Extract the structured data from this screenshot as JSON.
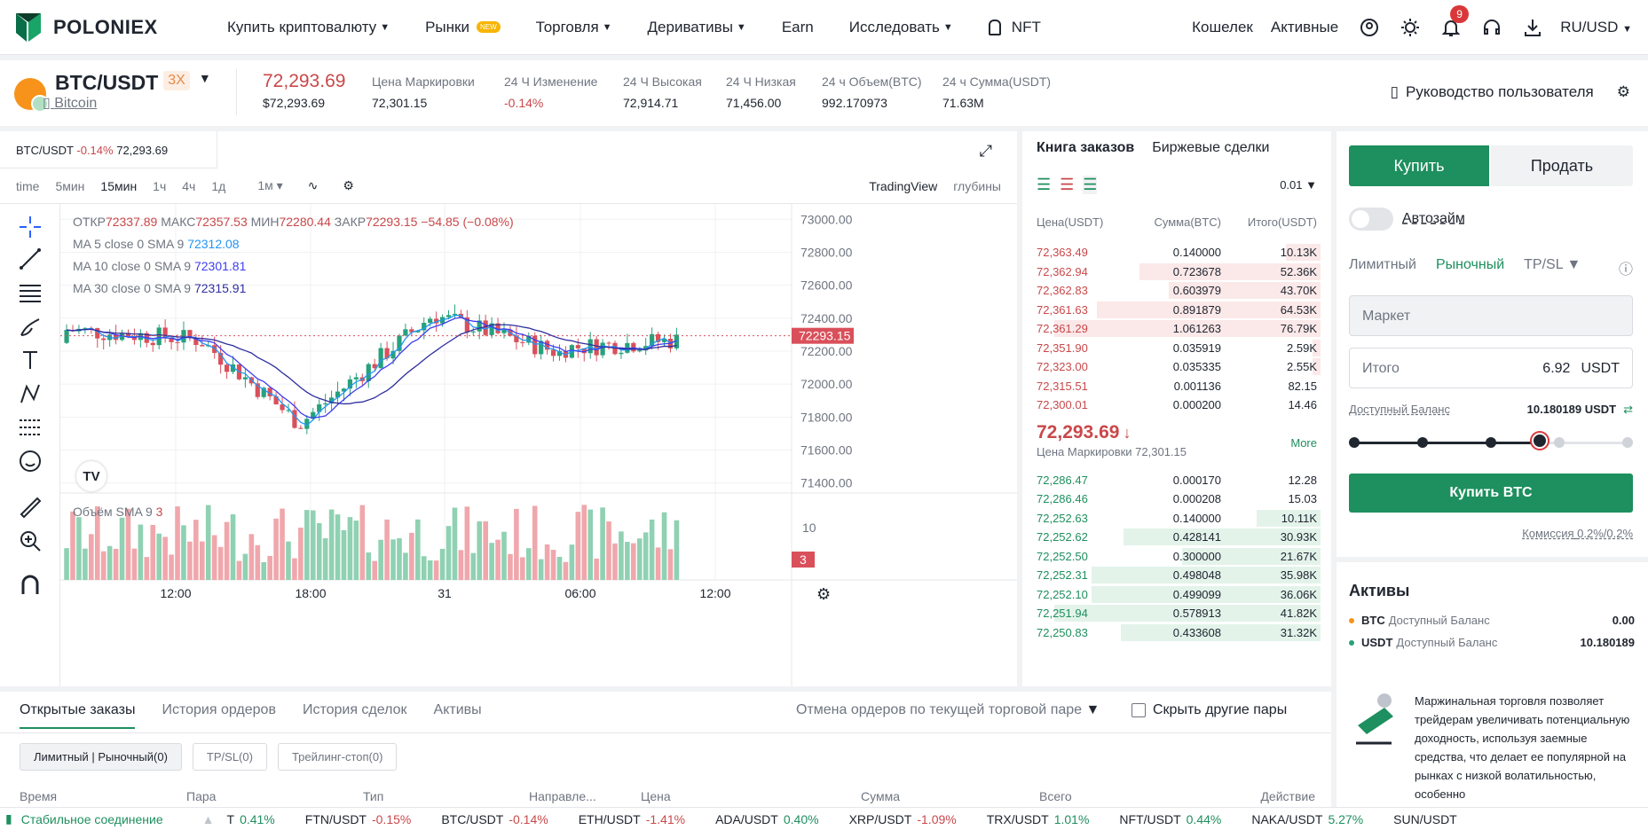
{
  "brand": {
    "name": "POLONIEX"
  },
  "nav": {
    "buy_crypto": "Купить криптовалюту",
    "markets": "Рынки",
    "markets_badge": "NEW",
    "trading": "Торговля",
    "derivatives": "Деривативы",
    "earn": "Earn",
    "explore": "Исследовать",
    "nft": "NFT",
    "wallet": "Кошелек",
    "assets": "Активные",
    "notif_count": "9",
    "lang": "RU/USD"
  },
  "ticker": {
    "pair": "BTC/USDT",
    "leverage": "3X",
    "coin_name": "Bitcoin",
    "last_price": "72,293.69",
    "last_price_usd": "$72,293.69",
    "stats": [
      {
        "label": "Цена Маркировки",
        "value": "72,301.15"
      },
      {
        "label": "24 Ч Изменение",
        "value": "-0.14%"
      },
      {
        "label": "24 Ч Высокая",
        "value": "72,914.71"
      },
      {
        "label": "24 Ч Низкая",
        "value": "71,456.00"
      },
      {
        "label": "24 ч Объем(BTC)",
        "value": "992.170973"
      },
      {
        "label": "24 ч Сумма(USDT)",
        "value": "71.63M"
      }
    ],
    "guide": "Руководство пользователя"
  },
  "chart": {
    "tab_pair": "BTC/USDT",
    "tab_change": "-0.14%",
    "tab_price": "72,293.69",
    "timeframes": [
      "time",
      "5мин",
      "15мин",
      "1ч",
      "4ч",
      "1д",
      "1м"
    ],
    "active_tf": "15мин",
    "view_tv": "TradingView",
    "view_depth": "глубины",
    "ohlc": {
      "o_label": "ОТКР",
      "o": "72337.89",
      "h_label": "МАКС",
      "h": "72357.53",
      "l_label": "МИН",
      "l": "72280.44",
      "c_label": "ЗАКР",
      "c": "72293.15",
      "chg": "−54.85 (−0.08%)"
    },
    "ma": [
      {
        "label": "MA 5 close 0 SMA 9",
        "value": "72312.08",
        "color": "#2196f3"
      },
      {
        "label": "MA 10 close 0 SMA 9",
        "value": "72301.81",
        "color": "#3d3df0"
      },
      {
        "label": "MA 30 close 0 SMA 9",
        "value": "72315.91",
        "color": "#2e2e9e"
      }
    ],
    "volume_label": "Объём SMA 9",
    "volume_value": "3",
    "price_ticks": [
      "73000.00",
      "72800.00",
      "72600.00",
      "72400.00",
      "72200.00",
      "72000.00",
      "71800.00",
      "71600.00",
      "71400.00"
    ],
    "current_price_tag": "72293.15",
    "vol_tick": "10",
    "vol_tag": "3",
    "time_ticks": [
      "12:00",
      "18:00",
      "31",
      "06:00",
      "12:00"
    ]
  },
  "chart_data": {
    "type": "candlestick",
    "x": [
      "12:00",
      "18:00",
      "31",
      "06:00",
      "12:00"
    ],
    "ylim": [
      71350,
      73050
    ],
    "last": 72293.15
  },
  "book": {
    "tab_book": "Книга заказов",
    "tab_trades": "Биржевые сделки",
    "precision": "0.01",
    "hdr_price": "Цена(USDT)",
    "hdr_size": "Сумма(BTC)",
    "hdr_total": "Итого(USDT)",
    "asks": [
      {
        "p": "72,363.49",
        "s": "0.140000",
        "t": "10.13K",
        "d": 0.13
      },
      {
        "p": "72,362.94",
        "s": "0.723678",
        "t": "52.36K",
        "d": 0.68
      },
      {
        "p": "72,362.83",
        "s": "0.603979",
        "t": "43.70K",
        "d": 0.57
      },
      {
        "p": "72,361.63",
        "s": "0.891879",
        "t": "64.53K",
        "d": 0.84
      },
      {
        "p": "72,361.29",
        "s": "1.061263",
        "t": "76.79K",
        "d": 1.0
      },
      {
        "p": "72,351.90",
        "s": "0.035919",
        "t": "2.59K",
        "d": 0.03
      },
      {
        "p": "72,323.00",
        "s": "0.035335",
        "t": "2.55K",
        "d": 0.03
      },
      {
        "p": "72,315.51",
        "s": "0.001136",
        "t": "82.15",
        "d": 0.0
      },
      {
        "p": "72,300.01",
        "s": "0.000200",
        "t": "14.46",
        "d": 0.0
      }
    ],
    "mid_price": "72,293.69",
    "mark_label": "Цена Маркировки 72,301.15",
    "more": "More",
    "bids": [
      {
        "p": "72,286.47",
        "s": "0.000170",
        "t": "12.28",
        "d": 0.0
      },
      {
        "p": "72,286.46",
        "s": "0.000208",
        "t": "15.03",
        "d": 0.0
      },
      {
        "p": "72,252.63",
        "s": "0.140000",
        "t": "10.11K",
        "d": 0.24
      },
      {
        "p": "72,252.62",
        "s": "0.428141",
        "t": "30.93K",
        "d": 0.74
      },
      {
        "p": "72,252.50",
        "s": "0.300000",
        "t": "21.67K",
        "d": 0.52
      },
      {
        "p": "72,252.31",
        "s": "0.498048",
        "t": "35.98K",
        "d": 0.86
      },
      {
        "p": "72,252.10",
        "s": "0.499099",
        "t": "36.06K",
        "d": 0.86
      },
      {
        "p": "72,251.94",
        "s": "0.578913",
        "t": "41.82K",
        "d": 1.0
      },
      {
        "p": "72,250.83",
        "s": "0.433608",
        "t": "31.32K",
        "d": 0.75
      }
    ]
  },
  "trade": {
    "buy": "Купить",
    "sell": "Продать",
    "autoloan": "Автозайм",
    "limit": "Лимитный",
    "market": "Рыночный",
    "tpsl": "TP/SL",
    "market_field": "Маркет",
    "total_label": "Итого",
    "total_value": "6.92",
    "total_unit": "USDT",
    "avail_label": "Доступный Баланс",
    "avail_value": "10.180189 USDT",
    "slider_level": 0.68,
    "submit": "Купить BTC",
    "fee_label": "Комиссия",
    "fee_value": "0.2%/0.2%"
  },
  "assets": {
    "title": "Активы",
    "rows": [
      {
        "coin": "BTC",
        "label": "Доступный Баланс",
        "value": "0.00",
        "color": "#f7931a"
      },
      {
        "coin": "USDT",
        "label": "Доступный Баланс",
        "value": "10.180189",
        "color": "#26a17b"
      }
    ]
  },
  "promo": {
    "text": "Маржинальная торговля позволяет трейдерам увеличивать потенциальную доходность, используя заемные средства, что делает ее популярной на рынках с низкой волатильностью, особенно"
  },
  "orders": {
    "tabs": [
      "Открытые заказы",
      "История ордеров",
      "История сделок",
      "Активы"
    ],
    "cancel": "Отмена ордеров по текущей торговой паре",
    "hide_other": "Скрыть другие пары",
    "filters": [
      "Лимитный | Рыночный(0)",
      "TP/SL(0)",
      "Трейлинг-стоп(0)"
    ],
    "cols": [
      "Время",
      "Пара",
      "Тип",
      "Направле...",
      "Цена",
      "Сумма",
      "Всего",
      "Действие"
    ]
  },
  "status": {
    "conn": "Стабильное соединение",
    "tickers": [
      {
        "pair": "T",
        "chg": "0.41%",
        "up": true
      },
      {
        "pair": "FTN/USDT",
        "chg": "-0.15%",
        "up": false
      },
      {
        "pair": "BTC/USDT",
        "chg": "-0.14%",
        "up": false
      },
      {
        "pair": "ETH/USDT",
        "chg": "-1.41%",
        "up": false
      },
      {
        "pair": "ADA/USDT",
        "chg": "0.40%",
        "up": true
      },
      {
        "pair": "XRP/USDT",
        "chg": "-1.09%",
        "up": false
      },
      {
        "pair": "TRX/USDT",
        "chg": "1.01%",
        "up": true
      },
      {
        "pair": "NFT/USDT",
        "chg": "0.44%",
        "up": true
      },
      {
        "pair": "NAKA/USDT",
        "chg": "5.27%",
        "up": true
      },
      {
        "pair": "SUN/USDT",
        "chg": "",
        "up": true
      }
    ]
  }
}
